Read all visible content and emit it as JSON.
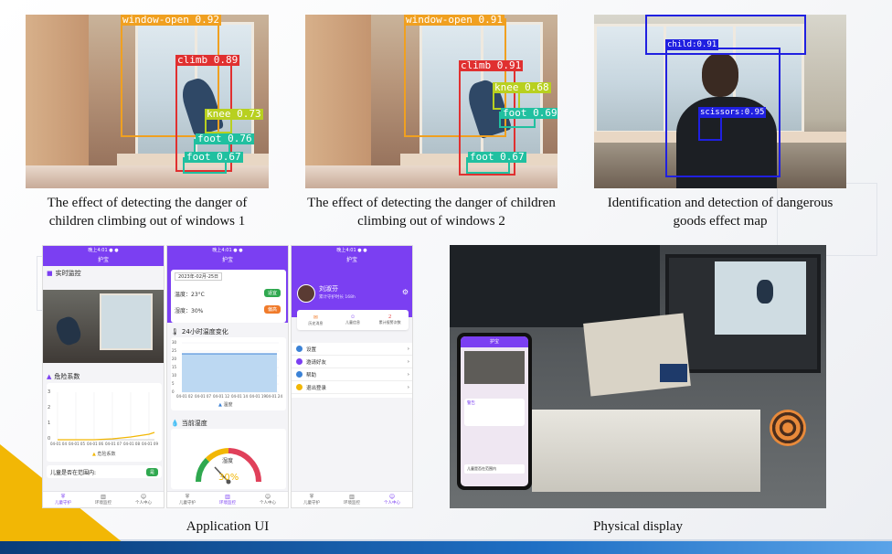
{
  "captions": {
    "photo1": "The effect of detecting the danger of children climbing out of windows 1",
    "photo2": "The effect of detecting the danger of children climbing out of windows 2",
    "photo3": "Identification and detection of dangerous goods effect map",
    "app": "Application UI",
    "physical": "Physical display"
  },
  "detections": {
    "photo1": [
      {
        "label": "window-open 0.92",
        "color": "#f0a020"
      },
      {
        "label": "climb 0.89",
        "color": "#e03030"
      },
      {
        "label": "knee 0.73",
        "color": "#b8d020"
      },
      {
        "label": "foot 0.76",
        "color": "#20c0a0"
      },
      {
        "label": "foot 0.67",
        "color": "#20c0a0"
      }
    ],
    "photo2": [
      {
        "label": "window-open 0.91",
        "color": "#f0a020"
      },
      {
        "label": "climb 0.91",
        "color": "#e03030"
      },
      {
        "label": "knee 0.68",
        "color": "#b8d020"
      },
      {
        "label": "foot 0.69",
        "color": "#20c0a0"
      },
      {
        "label": "foot 0.67",
        "color": "#20c0a0"
      }
    ],
    "photo3": [
      {
        "label": "child:0.91",
        "color": "#2020e0"
      },
      {
        "label": "scissors:0.95",
        "color": "#2020e0"
      }
    ]
  },
  "app": {
    "accent": "#7b3ff2",
    "status_text": "晚上4:01 ● ●",
    "screen1": {
      "title": "护宝",
      "section_monitor": "实时监控",
      "section_danger": "危险系数",
      "danger_legend": "危险系数",
      "danger_x": [
        "04-01 04",
        "04-01 05",
        "04-01 06",
        "04-01 07",
        "04-01 08",
        "04-01 09"
      ],
      "danger_y": [
        "3",
        "2",
        "1",
        "0"
      ],
      "range_text": "儿童是否在范围内:",
      "range_badge": "是",
      "tabs": [
        "儿童守护",
        "环境监控",
        "个人中心"
      ]
    },
    "screen2": {
      "title": "护宝",
      "date": "2023年-02月-25日",
      "temp": "温度：23°C",
      "temp_badge": "适宜",
      "humid": "湿度：30%",
      "humid_badge": "偏高",
      "section_temp": "24小时温度变化",
      "temp_y": [
        "30",
        "25",
        "20",
        "15",
        "10",
        "5",
        "0"
      ],
      "temp_x": [
        "04-01 02",
        "04-01 07",
        "04-01 12",
        "04-01 14",
        "04-01 19",
        "04-01 24"
      ],
      "temp_legend": "温度",
      "section_humid": "当前湿度",
      "gauge_label": "湿度",
      "gauge_value": "30%",
      "tabs": [
        "儿童守护",
        "环境监控",
        "个人中心"
      ]
    },
    "screen3": {
      "title": "护宝",
      "user_name": "刘淑芬",
      "user_sub": "累计守护时长 168h",
      "stats": [
        "历史消息",
        "儿童信息",
        "累计报警次数"
      ],
      "stat_badge": "2",
      "menu": [
        "设置",
        "邀请好友",
        "帮助",
        "退出登录"
      ],
      "tabs": [
        "儿童守护",
        "环境监控",
        "个人中心"
      ]
    }
  },
  "physical": {
    "phone_title": "护宝",
    "phone_alert": "警告",
    "phone_range": "儿童是否在范围内"
  }
}
